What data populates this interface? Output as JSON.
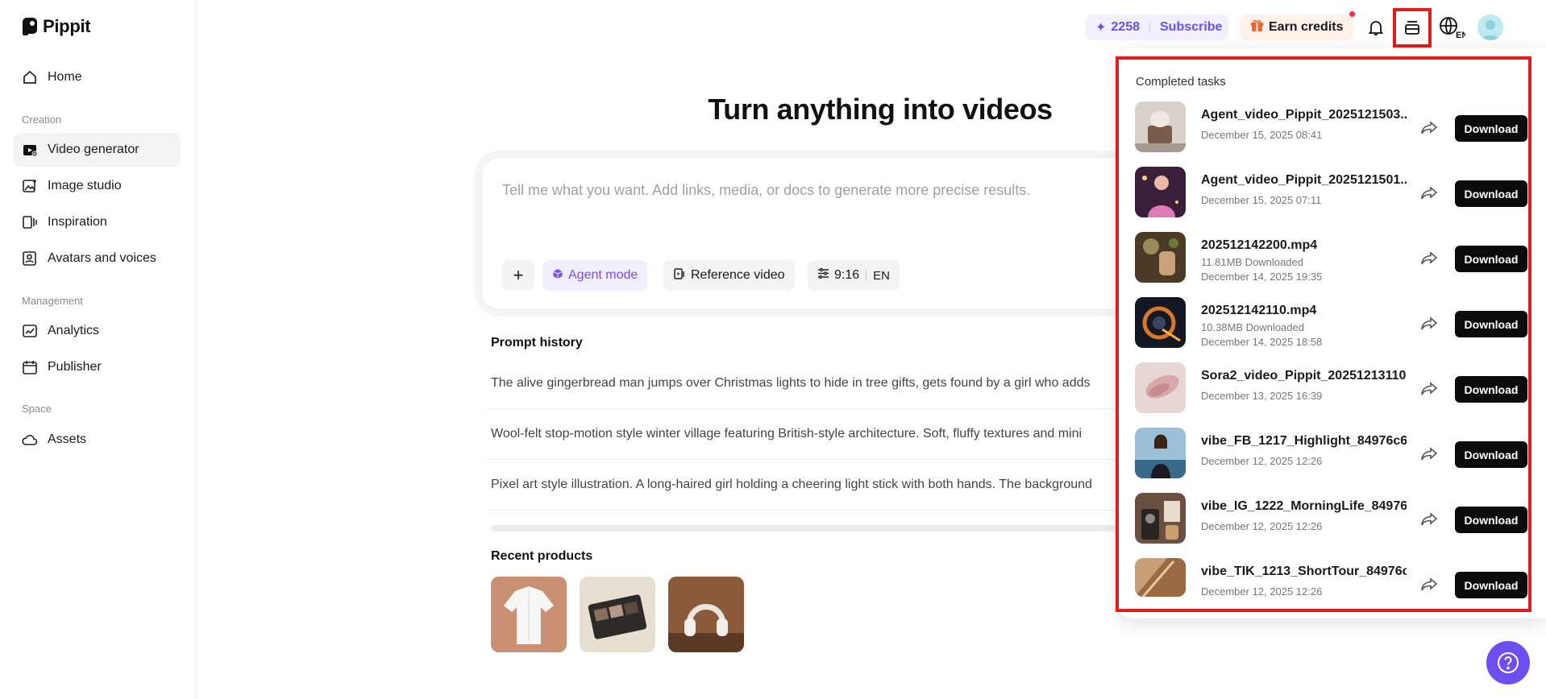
{
  "app": {
    "name": "Pippit"
  },
  "sidebar": {
    "items": [
      {
        "label": "Home",
        "icon": "home-icon"
      },
      {
        "label": "Video generator",
        "icon": "video-generator-icon",
        "active": true
      },
      {
        "label": "Image studio",
        "icon": "image-studio-icon"
      },
      {
        "label": "Inspiration",
        "icon": "inspiration-icon"
      },
      {
        "label": "Avatars and voices",
        "icon": "avatar-voice-icon"
      },
      {
        "label": "Analytics",
        "icon": "analytics-icon"
      },
      {
        "label": "Publisher",
        "icon": "calendar-icon"
      },
      {
        "label": "Assets",
        "icon": "cloud-icon"
      }
    ],
    "sections": {
      "creation": "Creation",
      "management": "Management",
      "space": "Space"
    }
  },
  "topbar": {
    "credits": "2258",
    "subscribe": "Subscribe",
    "earn_credits": "Earn credits",
    "language": "EN"
  },
  "main": {
    "title": "Turn anything into videos",
    "prompt_placeholder": "Tell me what you want. Add links, media, or docs to generate more precise results.",
    "chips": {
      "agent_mode": "Agent mode",
      "reference_video": "Reference video",
      "ratio": "9:16",
      "lang": "EN"
    },
    "prompt_history_title": "Prompt history",
    "prompt_history": [
      "The alive gingerbread man jumps over Christmas lights to hide in tree gifts, gets found by a girl who adds",
      "Wool-felt stop-motion style winter village featuring British-style architecture. Soft, fluffy textures and mini",
      "Pixel art style illustration. A long-haired girl holding a cheering light stick with both hands. The background"
    ],
    "recent_products_title": "Recent products"
  },
  "tasks": {
    "title": "Completed tasks",
    "download_label": "Download",
    "items": [
      {
        "name": "Agent_video_Pippit_2025121503...",
        "size": "",
        "date": "December 15, 2025 08:41"
      },
      {
        "name": "Agent_video_Pippit_2025121501...",
        "size": "",
        "date": "December 15, 2025 07:11"
      },
      {
        "name": "202512142200.mp4",
        "size": "11.81MB Downloaded",
        "date": "December 14, 2025 19:35"
      },
      {
        "name": "202512142110.mp4",
        "size": "10.38MB Downloaded",
        "date": "December 14, 2025 18:58"
      },
      {
        "name": "Sora2_video_Pippit_20251213110...",
        "size": "",
        "date": "December 13, 2025 16:39"
      },
      {
        "name": "vibe_FB_1217_Highlight_84976c6...",
        "size": "",
        "date": "December 12, 2025 12:26"
      },
      {
        "name": "vibe_IG_1222_MorningLife_84976...",
        "size": "",
        "date": "December 12, 2025 12:26"
      },
      {
        "name": "vibe_TIK_1213_ShortTour_84976c...",
        "size": "",
        "date": "December 12, 2025 12:26"
      }
    ]
  },
  "colors": {
    "accent": "#6d4ef0",
    "highlight": "#e21b1b"
  }
}
